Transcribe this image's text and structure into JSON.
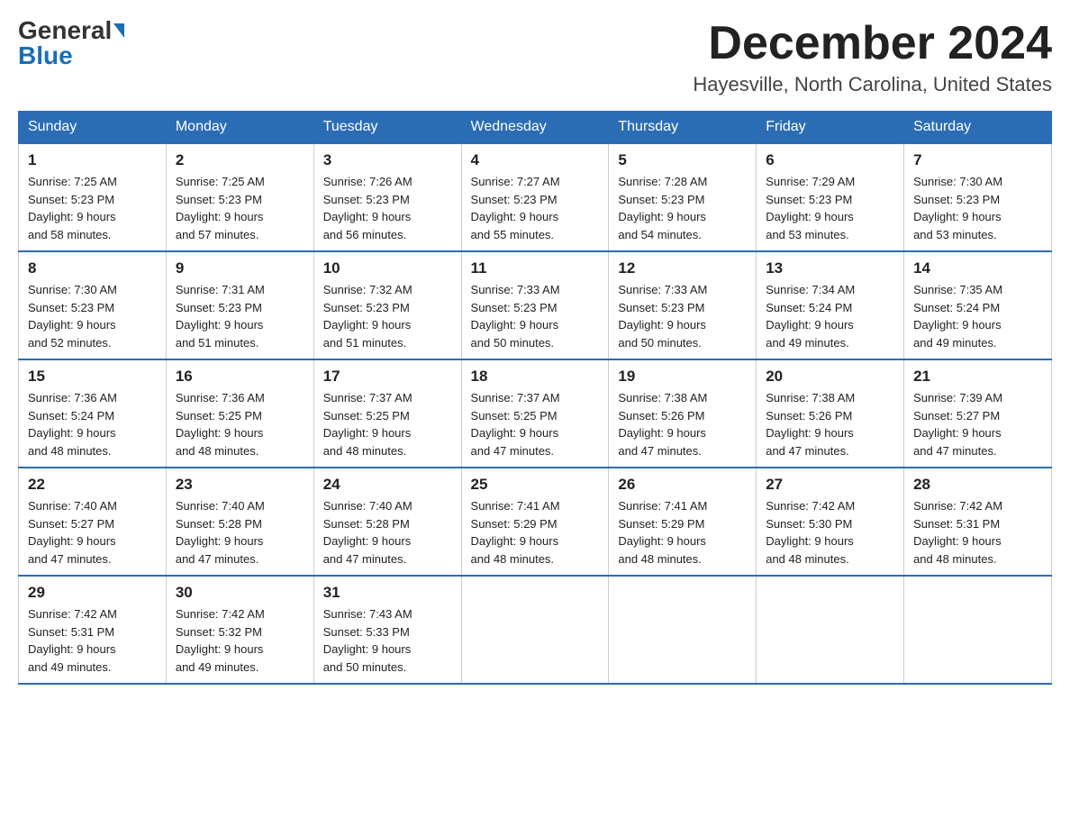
{
  "header": {
    "logo": {
      "general": "General",
      "blue": "Blue",
      "arrow": true
    },
    "title": "December 2024",
    "location": "Hayesville, North Carolina, United States"
  },
  "days_of_week": [
    "Sunday",
    "Monday",
    "Tuesday",
    "Wednesday",
    "Thursday",
    "Friday",
    "Saturday"
  ],
  "weeks": [
    [
      {
        "day": "1",
        "sunrise": "7:25 AM",
        "sunset": "5:23 PM",
        "daylight": "9 hours and 58 minutes."
      },
      {
        "day": "2",
        "sunrise": "7:25 AM",
        "sunset": "5:23 PM",
        "daylight": "9 hours and 57 minutes."
      },
      {
        "day": "3",
        "sunrise": "7:26 AM",
        "sunset": "5:23 PM",
        "daylight": "9 hours and 56 minutes."
      },
      {
        "day": "4",
        "sunrise": "7:27 AM",
        "sunset": "5:23 PM",
        "daylight": "9 hours and 55 minutes."
      },
      {
        "day": "5",
        "sunrise": "7:28 AM",
        "sunset": "5:23 PM",
        "daylight": "9 hours and 54 minutes."
      },
      {
        "day": "6",
        "sunrise": "7:29 AM",
        "sunset": "5:23 PM",
        "daylight": "9 hours and 53 minutes."
      },
      {
        "day": "7",
        "sunrise": "7:30 AM",
        "sunset": "5:23 PM",
        "daylight": "9 hours and 53 minutes."
      }
    ],
    [
      {
        "day": "8",
        "sunrise": "7:30 AM",
        "sunset": "5:23 PM",
        "daylight": "9 hours and 52 minutes."
      },
      {
        "day": "9",
        "sunrise": "7:31 AM",
        "sunset": "5:23 PM",
        "daylight": "9 hours and 51 minutes."
      },
      {
        "day": "10",
        "sunrise": "7:32 AM",
        "sunset": "5:23 PM",
        "daylight": "9 hours and 51 minutes."
      },
      {
        "day": "11",
        "sunrise": "7:33 AM",
        "sunset": "5:23 PM",
        "daylight": "9 hours and 50 minutes."
      },
      {
        "day": "12",
        "sunrise": "7:33 AM",
        "sunset": "5:23 PM",
        "daylight": "9 hours and 50 minutes."
      },
      {
        "day": "13",
        "sunrise": "7:34 AM",
        "sunset": "5:24 PM",
        "daylight": "9 hours and 49 minutes."
      },
      {
        "day": "14",
        "sunrise": "7:35 AM",
        "sunset": "5:24 PM",
        "daylight": "9 hours and 49 minutes."
      }
    ],
    [
      {
        "day": "15",
        "sunrise": "7:36 AM",
        "sunset": "5:24 PM",
        "daylight": "9 hours and 48 minutes."
      },
      {
        "day": "16",
        "sunrise": "7:36 AM",
        "sunset": "5:25 PM",
        "daylight": "9 hours and 48 minutes."
      },
      {
        "day": "17",
        "sunrise": "7:37 AM",
        "sunset": "5:25 PM",
        "daylight": "9 hours and 48 minutes."
      },
      {
        "day": "18",
        "sunrise": "7:37 AM",
        "sunset": "5:25 PM",
        "daylight": "9 hours and 47 minutes."
      },
      {
        "day": "19",
        "sunrise": "7:38 AM",
        "sunset": "5:26 PM",
        "daylight": "9 hours and 47 minutes."
      },
      {
        "day": "20",
        "sunrise": "7:38 AM",
        "sunset": "5:26 PM",
        "daylight": "9 hours and 47 minutes."
      },
      {
        "day": "21",
        "sunrise": "7:39 AM",
        "sunset": "5:27 PM",
        "daylight": "9 hours and 47 minutes."
      }
    ],
    [
      {
        "day": "22",
        "sunrise": "7:40 AM",
        "sunset": "5:27 PM",
        "daylight": "9 hours and 47 minutes."
      },
      {
        "day": "23",
        "sunrise": "7:40 AM",
        "sunset": "5:28 PM",
        "daylight": "9 hours and 47 minutes."
      },
      {
        "day": "24",
        "sunrise": "7:40 AM",
        "sunset": "5:28 PM",
        "daylight": "9 hours and 47 minutes."
      },
      {
        "day": "25",
        "sunrise": "7:41 AM",
        "sunset": "5:29 PM",
        "daylight": "9 hours and 48 minutes."
      },
      {
        "day": "26",
        "sunrise": "7:41 AM",
        "sunset": "5:29 PM",
        "daylight": "9 hours and 48 minutes."
      },
      {
        "day": "27",
        "sunrise": "7:42 AM",
        "sunset": "5:30 PM",
        "daylight": "9 hours and 48 minutes."
      },
      {
        "day": "28",
        "sunrise": "7:42 AM",
        "sunset": "5:31 PM",
        "daylight": "9 hours and 48 minutes."
      }
    ],
    [
      {
        "day": "29",
        "sunrise": "7:42 AM",
        "sunset": "5:31 PM",
        "daylight": "9 hours and 49 minutes."
      },
      {
        "day": "30",
        "sunrise": "7:42 AM",
        "sunset": "5:32 PM",
        "daylight": "9 hours and 49 minutes."
      },
      {
        "day": "31",
        "sunrise": "7:43 AM",
        "sunset": "5:33 PM",
        "daylight": "9 hours and 50 minutes."
      },
      null,
      null,
      null,
      null
    ]
  ],
  "labels": {
    "sunrise_prefix": "Sunrise: ",
    "sunset_prefix": "Sunset: ",
    "daylight_prefix": "Daylight: "
  }
}
